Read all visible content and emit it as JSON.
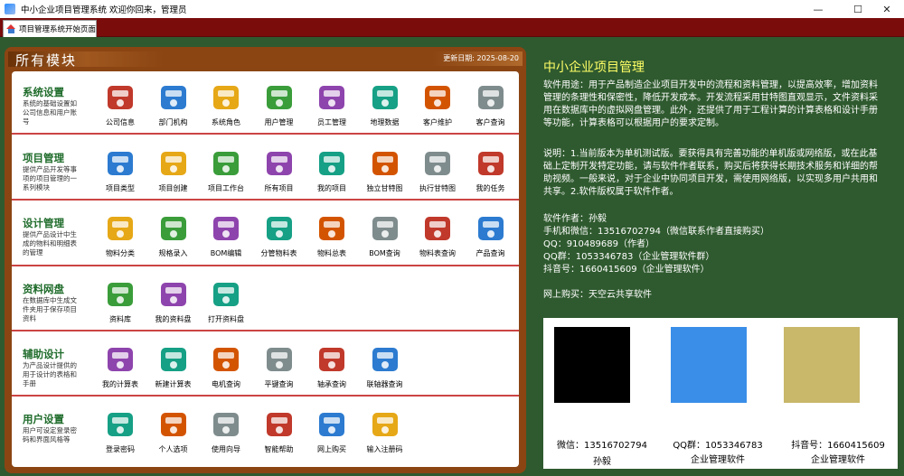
{
  "window": {
    "title": "中小企业项目管理系统  欢迎你回来，管理员",
    "minimize": "—",
    "maximize": "☐",
    "close": "✕"
  },
  "tab": {
    "label": "项目管理系统开始页面"
  },
  "left": {
    "title": "所有模块",
    "date": "更新日期: 2025-08-20",
    "sections": [
      {
        "title": "系统设置",
        "desc": "系统的基础设置如公司信息和用户账号",
        "items": [
          "公司信息",
          "部门机构",
          "系统角色",
          "用户管理",
          "员工管理",
          "地理数据",
          "客户维护",
          "客户查询"
        ]
      },
      {
        "title": "项目管理",
        "desc": "提供产品开发等事项的项目管理的一系列模块",
        "items": [
          "项目类型",
          "项目创建",
          "项目工作台",
          "所有项目",
          "我的项目",
          "独立甘特图",
          "执行甘特图",
          "我的任务"
        ]
      },
      {
        "title": "设计管理",
        "desc": "提供产品设计中生成的物料和明细表的管理",
        "items": [
          "物料分类",
          "规格录入",
          "BOM编辑",
          "分管物料表",
          "物料总表",
          "BOM查询",
          "物料表查询",
          "产品查询"
        ]
      },
      {
        "title": "资料网盘",
        "desc": "在数据库中生成文件夹用于保存项目资料",
        "items": [
          "资料库",
          "我的资料盘",
          "打开资料盘"
        ]
      },
      {
        "title": "辅助设计",
        "desc": "为产品设计提供的用于设计的表格和手册",
        "items": [
          "我的计算表",
          "新建计算表",
          "电机查询",
          "平键查询",
          "轴承查询",
          "联轴器查询"
        ]
      },
      {
        "title": "用户设置",
        "desc": "用户可设定登录密码和界面风格等",
        "items": [
          "登录密码",
          "个人选项",
          "使用向导",
          "智能帮助",
          "网上购买",
          "输入注册码"
        ]
      }
    ]
  },
  "right": {
    "title": "中小企业项目管理",
    "usage": "软件用途：用于产品制造企业项目开发中的流程和资料管理，以提高效率，增加资料管理的条理性和保密性，降低开发成本。开发流程采用甘特图直观显示，文件资料采用在数据库中的虚拟网盘管理。此外，还提供了用于工程计算的计算表格和设计手册等功能，计算表格可以根据用户的要求定制。",
    "note": "说明：1.当前版本为单机测试版。要获得具有完善功能的单机版或网络版，或在此基础上定制开发特定功能，请与软件作者联系，购买后将获得长期技术服务和详细的帮助视频。一般来说，对于企业中协同项目开发，需使用网络版，以实现多用户共用和共享。2.软件版权属于软件作者。",
    "contacts": [
      "软件作者：孙毅",
      "手机和微信：13516702794（微信联系作者直接购买）",
      "QQ：910489689（作者）",
      "QQ群：1053346783（企业管理软件群）",
      "抖音号：1660415609（企业管理软件）"
    ],
    "buy": "网上购买：天空云共享软件",
    "qrcodes": [
      {
        "line1": "微信：13516702794",
        "line2": "孙毅"
      },
      {
        "line1": "QQ群：1053346783",
        "line2": "企业管理软件"
      },
      {
        "line1": "抖音号：1660415609",
        "line2": "企业管理软件"
      }
    ]
  },
  "colors": {
    "tabbar": "#7a0c0c",
    "left_frame": "#8b4513",
    "right_bg": "#2f5a2f",
    "section_title": "#1e6b2a",
    "right_title": "#ffff66"
  }
}
